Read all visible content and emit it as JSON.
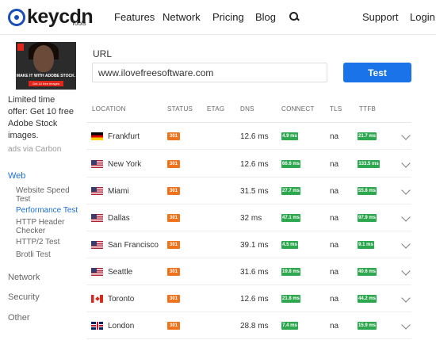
{
  "header": {
    "logo_text": "keycdn",
    "logo_sub": "Tools",
    "nav": [
      "Features",
      "Network",
      "Pricing",
      "Blog"
    ],
    "right_nav": [
      "Support",
      "Login"
    ]
  },
  "ad": {
    "image_caption": "MAKE IT WITH ADOBE STOCK.",
    "image_cta": "Get 10 free images",
    "text": "Limited time offer: Get 10 free Adobe Stock images.",
    "via": "ads via Carbon"
  },
  "sidebar": {
    "web": "Web",
    "items": [
      {
        "label": "Website Speed Test",
        "active": false
      },
      {
        "label": "Performance Test",
        "active": true
      },
      {
        "label": "HTTP Header Checker",
        "active": false
      },
      {
        "label": "HTTP/2 Test",
        "active": false
      },
      {
        "label": "Brotli Test",
        "active": false
      }
    ],
    "network": "Network",
    "security": "Security",
    "other": "Other"
  },
  "form": {
    "url_label": "URL",
    "url_value": "www.ilovefreesoftware.com",
    "test_label": "Test"
  },
  "table": {
    "headers": [
      "LOCATION",
      "STATUS",
      "ETAG",
      "DNS",
      "CONNECT",
      "TLS",
      "TTFB"
    ],
    "rows": [
      {
        "location": "Frankfurt",
        "flag": "de",
        "status": "301",
        "dns": "12.6 ms",
        "connect": "4.9 ms",
        "tls": "na",
        "ttfb": "21.7 ms"
      },
      {
        "location": "New York",
        "flag": "us",
        "status": "301",
        "dns": "12.6 ms",
        "connect": "66.6 ms",
        "tls": "na",
        "ttfb": "133.5 ms"
      },
      {
        "location": "Miami",
        "flag": "us",
        "status": "301",
        "dns": "31.5 ms",
        "connect": "27.7 ms",
        "tls": "na",
        "ttfb": "55.8 ms"
      },
      {
        "location": "Dallas",
        "flag": "us",
        "status": "301",
        "dns": "32 ms",
        "connect": "47.1 ms",
        "tls": "na",
        "ttfb": "97.9 ms"
      },
      {
        "location": "San Francisco",
        "flag": "us",
        "status": "301",
        "dns": "39.1 ms",
        "connect": "4.5 ms",
        "tls": "na",
        "ttfb": "9.1 ms"
      },
      {
        "location": "Seattle",
        "flag": "us",
        "status": "301",
        "dns": "31.6 ms",
        "connect": "19.8 ms",
        "tls": "na",
        "ttfb": "40.6 ms"
      },
      {
        "location": "Toronto",
        "flag": "ca",
        "status": "301",
        "dns": "12.6 ms",
        "connect": "21.8 ms",
        "tls": "na",
        "ttfb": "44.2 ms"
      },
      {
        "location": "London",
        "flag": "gb",
        "status": "301",
        "dns": "28.8 ms",
        "connect": "7.4 ms",
        "tls": "na",
        "ttfb": "15.9 ms"
      }
    ]
  },
  "colors": {
    "accent": "#1a73e8",
    "status_badge": "#f0731b",
    "timing_badge": "#2ea84f",
    "active_link": "#1a6fd6"
  }
}
